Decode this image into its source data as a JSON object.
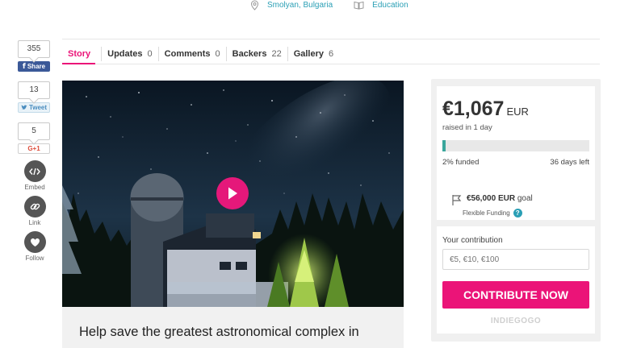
{
  "meta": {
    "location": "Smolyan, Bulgaria",
    "category": "Education"
  },
  "share": {
    "facebook": {
      "count": "355",
      "label": "Share"
    },
    "twitter": {
      "count": "13",
      "label": "Tweet"
    },
    "google": {
      "count": "5",
      "label": "G+1"
    },
    "embed_label": "Embed",
    "link_label": "Link",
    "follow_label": "Follow"
  },
  "tabs": [
    {
      "label": "Story",
      "count": ""
    },
    {
      "label": "Updates",
      "count": "0"
    },
    {
      "label": "Comments",
      "count": "0"
    },
    {
      "label": "Backers",
      "count": "22"
    },
    {
      "label": "Gallery",
      "count": "6"
    }
  ],
  "campaign": {
    "title": "Help save the greatest astronomical complex in"
  },
  "funding": {
    "amount": "€1,067",
    "currency": "EUR",
    "raised_text": "raised in 1 day",
    "percent_funded": 2,
    "funded_text": "2% funded",
    "days_left": "36 days left",
    "goal_amount": "€56,000",
    "goal_currency": "EUR",
    "goal_word": "goal",
    "funding_type": "Flexible Funding",
    "help_glyph": "?"
  },
  "contribution": {
    "label": "Your contribution",
    "placeholder": "€5, €10, €100",
    "button_label": "CONTRIBUTE NOW",
    "brand": "INDIEGOGO"
  },
  "colors": {
    "accent": "#eb1478",
    "link": "#2a9fb5",
    "progress": "#3aa69c",
    "facebook": "#3b5998"
  },
  "icons": {
    "location": "map-pin-icon",
    "category": "book-icon",
    "play": "play-icon",
    "embed": "code-icon",
    "link": "link-icon",
    "follow": "heart-icon",
    "goal": "flag-icon",
    "help": "help-icon"
  }
}
